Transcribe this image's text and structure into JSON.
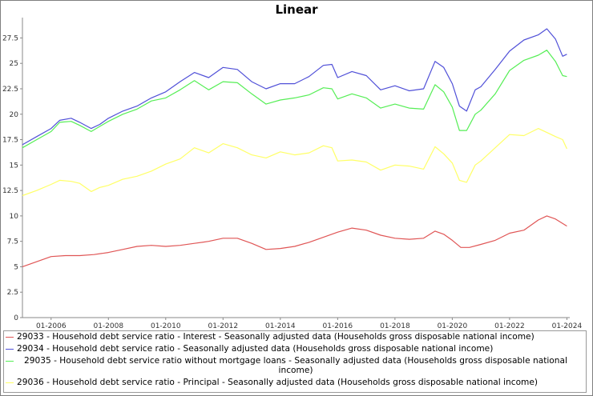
{
  "chart_data": {
    "type": "line",
    "title": "Linear",
    "xlabel": "",
    "ylabel": "",
    "xlim": [
      2005.0,
      2024.1
    ],
    "ylim": [
      0,
      29.5
    ],
    "grid": false,
    "legend_position": "bottom",
    "x_ticks": [
      "01-2006",
      "01-2008",
      "01-2010",
      "01-2012",
      "01-2014",
      "01-2016",
      "01-2018",
      "01-2020",
      "01-2022",
      "01-2024"
    ],
    "x_tick_values": [
      2006,
      2008,
      2010,
      2012,
      2014,
      2016,
      2018,
      2020,
      2022,
      2024
    ],
    "y_ticks": [
      "0",
      "2.5",
      "5",
      "7.5",
      "10",
      "12.5",
      "15",
      "17.5",
      "20",
      "22.5",
      "25",
      "27.5"
    ],
    "y_tick_values": [
      0,
      2.5,
      5,
      7.5,
      10,
      12.5,
      15,
      17.5,
      20,
      22.5,
      25,
      27.5
    ],
    "series": [
      {
        "name": "29033 - Household debt service ratio - Interest - Seasonally adjusted data (Households gross disposable national income)",
        "color": "#e05555",
        "x": [
          2005.0,
          2005.5,
          2006.0,
          2006.5,
          2007.0,
          2007.5,
          2008.0,
          2008.5,
          2009.0,
          2009.5,
          2010.0,
          2010.5,
          2011.0,
          2011.5,
          2012.0,
          2012.5,
          2013.0,
          2013.5,
          2014.0,
          2014.5,
          2015.0,
          2015.5,
          2016.0,
          2016.5,
          2017.0,
          2017.5,
          2018.0,
          2018.5,
          2019.0,
          2019.4,
          2019.7,
          2020.0,
          2020.3,
          2020.6,
          2021.0,
          2021.5,
          2022.0,
          2022.5,
          2023.0,
          2023.3,
          2023.6,
          2024.0
        ],
        "y": [
          5.0,
          5.5,
          6.0,
          6.1,
          6.1,
          6.2,
          6.4,
          6.7,
          7.0,
          7.1,
          7.0,
          7.1,
          7.3,
          7.5,
          7.8,
          7.8,
          7.3,
          6.7,
          6.8,
          7.0,
          7.4,
          7.9,
          8.4,
          8.8,
          8.6,
          8.1,
          7.8,
          7.7,
          7.8,
          8.5,
          8.2,
          7.6,
          6.9,
          6.9,
          7.2,
          7.6,
          8.3,
          8.6,
          9.6,
          10.0,
          9.7,
          9.0
        ]
      },
      {
        "name": "29034 - Household debt service ratio - Seasonally adjusted data (Households gross disposable national income)",
        "color": "#5050d8",
        "x": [
          2005.0,
          2005.5,
          2006.0,
          2006.3,
          2006.7,
          2007.0,
          2007.4,
          2007.7,
          2008.0,
          2008.5,
          2009.0,
          2009.5,
          2010.0,
          2010.5,
          2011.0,
          2011.5,
          2012.0,
          2012.5,
          2013.0,
          2013.5,
          2014.0,
          2014.5,
          2015.0,
          2015.5,
          2015.8,
          2016.0,
          2016.5,
          2017.0,
          2017.5,
          2018.0,
          2018.5,
          2019.0,
          2019.4,
          2019.7,
          2020.0,
          2020.25,
          2020.5,
          2020.8,
          2021.0,
          2021.5,
          2022.0,
          2022.5,
          2023.0,
          2023.3,
          2023.6,
          2023.85,
          2024.0
        ],
        "y": [
          17.0,
          17.8,
          18.6,
          19.4,
          19.6,
          19.2,
          18.6,
          19.0,
          19.6,
          20.3,
          20.8,
          21.6,
          22.2,
          23.2,
          24.1,
          23.6,
          24.6,
          24.4,
          23.2,
          22.5,
          23.0,
          23.0,
          23.7,
          24.8,
          24.9,
          23.6,
          24.2,
          23.8,
          22.4,
          22.8,
          22.3,
          22.5,
          25.2,
          24.6,
          23.0,
          20.8,
          20.3,
          22.4,
          22.7,
          24.4,
          26.2,
          27.3,
          27.8,
          28.4,
          27.4,
          25.7,
          25.9
        ]
      },
      {
        "name": "29035 - Household debt service ratio without mortgage loans - Seasonally adjusted data (Households gross disposable national income)",
        "color": "#55ee55",
        "x": [
          2005.0,
          2005.5,
          2006.0,
          2006.3,
          2006.7,
          2007.0,
          2007.4,
          2007.7,
          2008.0,
          2008.5,
          2009.0,
          2009.5,
          2010.0,
          2010.5,
          2011.0,
          2011.5,
          2012.0,
          2012.5,
          2013.0,
          2013.5,
          2014.0,
          2014.5,
          2015.0,
          2015.5,
          2015.8,
          2016.0,
          2016.5,
          2017.0,
          2017.5,
          2018.0,
          2018.5,
          2019.0,
          2019.4,
          2019.7,
          2020.0,
          2020.25,
          2020.5,
          2020.8,
          2021.0,
          2021.5,
          2022.0,
          2022.5,
          2023.0,
          2023.3,
          2023.6,
          2023.85,
          2024.0
        ],
        "y": [
          16.7,
          17.5,
          18.3,
          19.2,
          19.3,
          18.9,
          18.3,
          18.8,
          19.3,
          20.0,
          20.5,
          21.3,
          21.6,
          22.4,
          23.3,
          22.4,
          23.2,
          23.1,
          22.0,
          21.0,
          21.4,
          21.6,
          21.9,
          22.6,
          22.5,
          21.5,
          22.0,
          21.6,
          20.6,
          21.0,
          20.6,
          20.5,
          22.9,
          22.2,
          20.7,
          18.4,
          18.4,
          20.0,
          20.4,
          22.0,
          24.3,
          25.3,
          25.8,
          26.3,
          25.2,
          23.8,
          23.7
        ]
      },
      {
        "name": "29036 - Household debt service ratio - Principal - Seasonally adjusted data (Households gross disposable national income)",
        "color": "#ffff66",
        "x": [
          2005.0,
          2005.5,
          2006.0,
          2006.3,
          2006.7,
          2007.0,
          2007.4,
          2007.7,
          2008.0,
          2008.5,
          2009.0,
          2009.5,
          2010.0,
          2010.5,
          2011.0,
          2011.5,
          2012.0,
          2012.5,
          2013.0,
          2013.5,
          2014.0,
          2014.5,
          2015.0,
          2015.5,
          2015.8,
          2016.0,
          2016.5,
          2017.0,
          2017.5,
          2018.0,
          2018.5,
          2019.0,
          2019.4,
          2019.7,
          2020.0,
          2020.25,
          2020.5,
          2020.8,
          2021.0,
          2021.5,
          2022.0,
          2022.5,
          2023.0,
          2023.3,
          2023.6,
          2023.85,
          2024.0
        ],
        "y": [
          12.0,
          12.5,
          13.1,
          13.5,
          13.4,
          13.2,
          12.4,
          12.8,
          13.0,
          13.6,
          13.9,
          14.4,
          15.1,
          15.6,
          16.7,
          16.2,
          17.1,
          16.7,
          16.0,
          15.7,
          16.3,
          16.0,
          16.2,
          16.9,
          16.7,
          15.4,
          15.5,
          15.3,
          14.5,
          15.0,
          14.9,
          14.6,
          16.8,
          16.1,
          15.2,
          13.5,
          13.3,
          15.0,
          15.4,
          16.7,
          18.0,
          17.9,
          18.6,
          18.2,
          17.8,
          17.5,
          16.6
        ]
      }
    ]
  }
}
